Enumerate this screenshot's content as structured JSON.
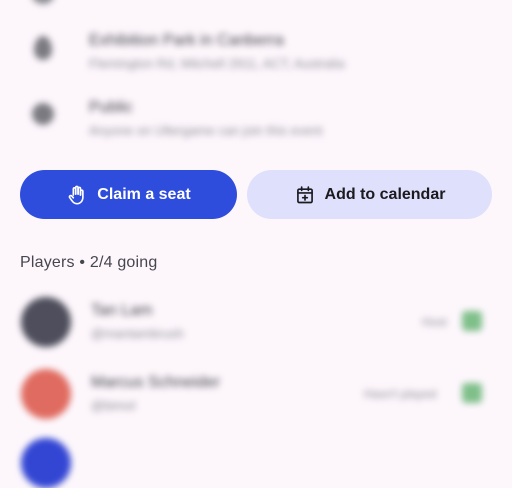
{
  "info_rows": [
    {
      "icon": "location-pin-icon",
      "title": "Exhibition Park in Canberra",
      "subtitle": "Flemington Rd, Mitchell 2911, ACT, Australia"
    },
    {
      "icon": "globe-icon",
      "title": "Public",
      "subtitle": "Anyone on Ultergame can join this event"
    }
  ],
  "actions": {
    "claim_seat_label": "Claim a seat",
    "claim_seat_icon": "hand-icon",
    "add_calendar_label": "Add to calendar",
    "add_calendar_icon": "calendar-add-icon"
  },
  "players": {
    "header": "Players • 2/4 going",
    "list": [
      {
        "name": "Tan Lam",
        "handle": "@mantambrush",
        "status": "Host",
        "avatar_color": "#4e4e5c"
      },
      {
        "name": "Marcus Schneider",
        "handle": "@bimol",
        "status": "Hasn't played",
        "avatar_color": "#e06b60"
      }
    ]
  },
  "colors": {
    "background": "#fdf7fc",
    "primary": "#2f4ddc",
    "secondary_container": "#dfe0fb",
    "third_avatar": "#3346d3"
  }
}
